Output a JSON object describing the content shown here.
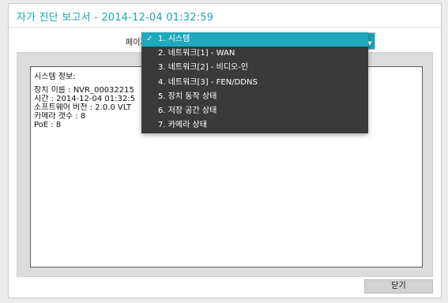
{
  "dialog": {
    "title": "자가 진단 보고서 - 2014-12-04 01:32:59"
  },
  "page": {
    "label": "페이지"
  },
  "dropdown": {
    "items": [
      {
        "label": "1. 시스템",
        "selected": true
      },
      {
        "label": "2. 네트워크[1] - WAN",
        "selected": false
      },
      {
        "label": "3. 네트워크[2] - 비디오-인",
        "selected": false
      },
      {
        "label": "4. 네트워크[3] - FEN/DDNS",
        "selected": false
      },
      {
        "label": "5. 장치 동작 상태",
        "selected": false
      },
      {
        "label": "6. 저장 공간 상태",
        "selected": false
      },
      {
        "label": "7. 카메라 상태",
        "selected": false
      }
    ],
    "check_glyph": "✓"
  },
  "info": {
    "heading": "시스템 정보:",
    "lines": [
      "장치 이름 : NVR_00032215",
      "시간 : 2014-12-04 01:32:5",
      "소프트웨어 버전 : 2.0.0 VLT",
      "카메라 갯수 : 8",
      "PoE : 8"
    ]
  },
  "buttons": {
    "close_label": "닫기"
  },
  "colors": {
    "accent": "#1aa3b8",
    "dropdown_bg": "#3a3a3a",
    "selected_bg": "#1fa9bd"
  }
}
